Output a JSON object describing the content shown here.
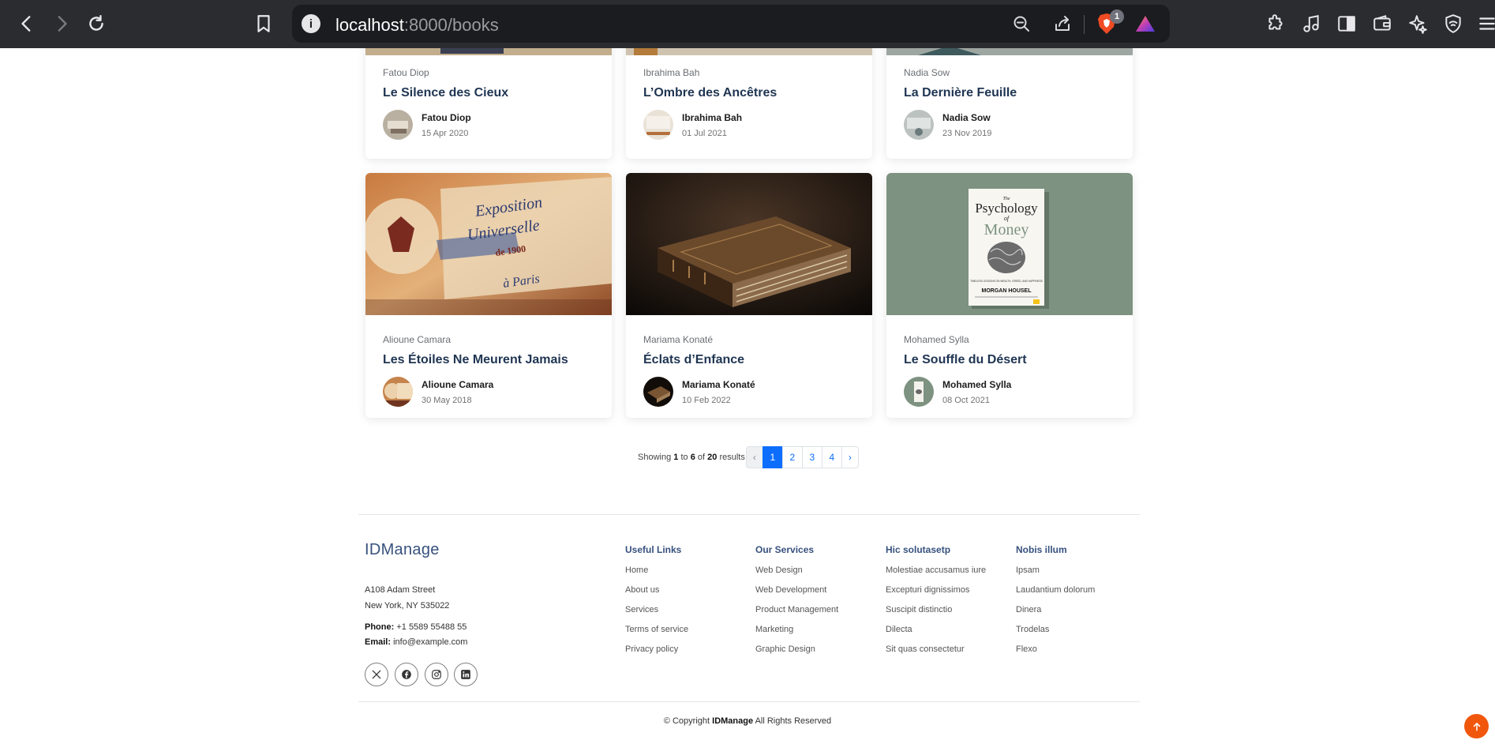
{
  "browser": {
    "url_host": "localhost",
    "url_rest": ":8000/books",
    "shields_count": "1"
  },
  "top_cards": [
    {
      "author_label": "Fatou Diop",
      "title": "Le Silence des Cieux",
      "author": "Fatou Diop",
      "date": "15 Apr 2020"
    },
    {
      "author_label": "Ibrahima Bah",
      "title": "L’Ombre des Ancêtres",
      "author": "Ibrahima Bah",
      "date": "01 Jul 2021"
    },
    {
      "author_label": "Nadia Sow",
      "title": "La Dernière Feuille",
      "author": "Nadia Sow",
      "date": "23 Nov 2019"
    }
  ],
  "cards": [
    {
      "author_label": "Alioune Camara",
      "title": "Les Étoiles Ne Meurent Jamais",
      "author": "Alioune Camara",
      "date": "30 May 2018",
      "image_text": {
        "line1": "Exposition",
        "line2": "Universelle",
        "line3": "de 1900",
        "line4": "à Paris"
      }
    },
    {
      "author_label": "Mariama Konaté",
      "title": "Éclats d’Enfance",
      "author": "Mariama Konaté",
      "date": "10 Feb 2022"
    },
    {
      "author_label": "Mohamed Sylla",
      "title": "Le Souffle du Désert",
      "author": "Mohamed Sylla",
      "date": "08 Oct 2021",
      "image_text": {
        "the": "The",
        "psychology": "Psychology",
        "of": "of",
        "money": "Money",
        "subtitle": "TIMELESS LESSONS ON WEALTH, GREED, AND HAPPINESS",
        "author": "MORGAN HOUSEL"
      }
    }
  ],
  "pagination": {
    "showing": "Showing",
    "from": "1",
    "to_word": "to",
    "to": "6",
    "of_word": "of",
    "total": "20",
    "results_word": "results",
    "prev": "‹",
    "pages": [
      "1",
      "2",
      "3",
      "4"
    ],
    "next": "›",
    "active": "1"
  },
  "footer": {
    "brand": "IDManage",
    "address1": "A108 Adam Street",
    "address2": "New York, NY 535022",
    "phone_label": "Phone:",
    "phone": "+1 5589 55488 55",
    "email_label": "Email:",
    "email": "info@example.com",
    "columns": [
      {
        "heading": "Useful Links",
        "links": [
          "Home",
          "About us",
          "Services",
          "Terms of service",
          "Privacy policy"
        ]
      },
      {
        "heading": "Our Services",
        "links": [
          "Web Design",
          "Web Development",
          "Product Management",
          "Marketing",
          "Graphic Design"
        ]
      },
      {
        "heading": "Hic solutasetp",
        "links": [
          "Molestiae accusamus iure",
          "Excepturi dignissimos",
          "Suscipit distinctio",
          "Dilecta",
          "Sit quas consectetur"
        ]
      },
      {
        "heading": "Nobis illum",
        "links": [
          "Ipsam",
          "Laudantium dolorum",
          "Dinera",
          "Trodelas",
          "Flexo"
        ]
      }
    ],
    "copyright_prefix": "© Copyright",
    "copyright_brand": "IDManage",
    "copyright_suffix": "All Rights Reserved"
  },
  "colors": {
    "accent": "#0d6efd",
    "title": "#1f3552",
    "brand": "#37517e",
    "to_top": "#f0570d"
  },
  "icons": [
    "back-icon",
    "forward-icon",
    "reload-icon",
    "bookmark-icon",
    "site-info-icon",
    "zoom-out-icon",
    "share-icon",
    "brave-shields-icon",
    "brave-rewards-icon",
    "extensions-icon",
    "media-icon",
    "sidebar-icon",
    "wallet-icon",
    "leo-icon",
    "vpn-icon",
    "x-icon",
    "facebook-icon",
    "instagram-icon",
    "linkedin-icon",
    "arrow-up-icon"
  ]
}
